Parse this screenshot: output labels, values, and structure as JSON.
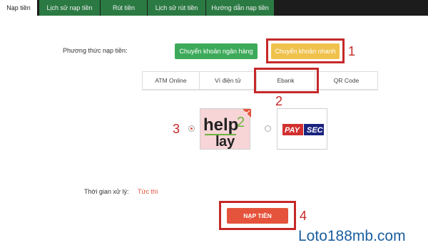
{
  "top_tabs": [
    {
      "label": "Nạp tiền",
      "active": true
    },
    {
      "label": "Lịch sử nạp tiền",
      "active": false
    },
    {
      "label": "Rút tiền",
      "active": false
    },
    {
      "label": "Lịch sử rút tiền",
      "active": false
    },
    {
      "label": "Hướng dẫn nạp tiền",
      "active": false
    }
  ],
  "method": {
    "label": "Phương thức nạp tiền:",
    "bank_transfer": "Chuyển khoản ngân hàng",
    "quick_transfer": "Chuyển khoản nhanh"
  },
  "sub_tabs": [
    {
      "label": "ATM Online",
      "active": false
    },
    {
      "label": "Ví điện tử",
      "active": false
    },
    {
      "label": "Ebank",
      "active": true
    },
    {
      "label": "QR Code",
      "active": false
    }
  ],
  "providers": {
    "help2pay": {
      "name": "help2pay",
      "selected": true
    },
    "paysec": {
      "name_left": "PAY",
      "name_right": "SEC",
      "selected": false
    }
  },
  "processing": {
    "label": "Thời gian xử lý:",
    "value": "Tức thì"
  },
  "submit_label": "NẠP TIỀN",
  "steps": [
    "1",
    "2",
    "3",
    "4"
  ],
  "watermark": "Loto188mb.com",
  "colors": {
    "accent_red": "#c62828",
    "green": "#3daa5a",
    "yellow": "#f0c24c",
    "orange": "#e5533c",
    "dark": "#1c1c1c"
  }
}
